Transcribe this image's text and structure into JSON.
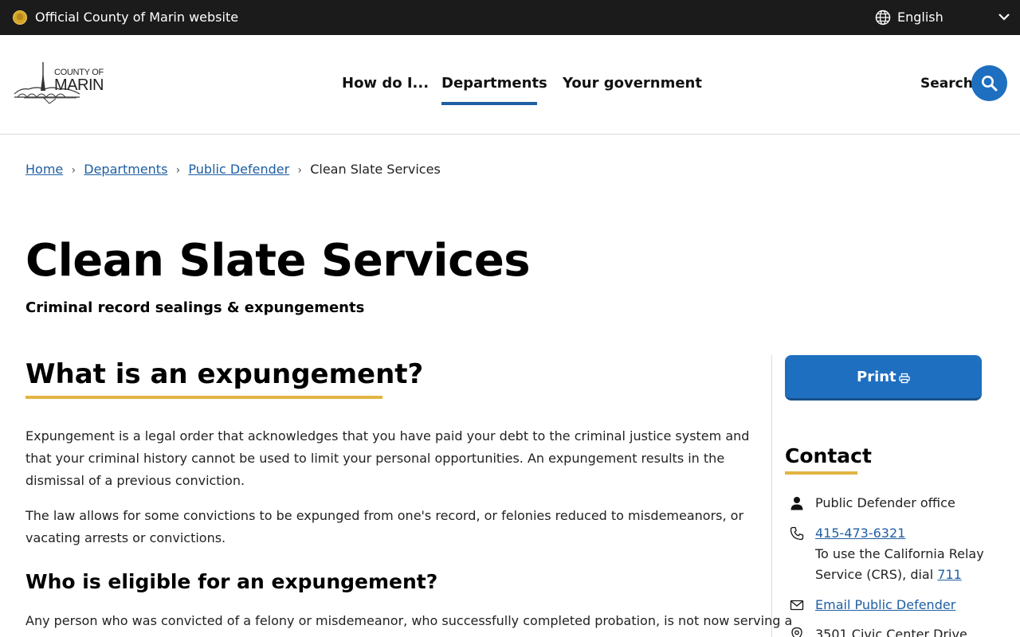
{
  "topbar": {
    "title": "Official County of Marin website",
    "language": "English"
  },
  "logo": {
    "top": "COUNTY OF",
    "main": "MARIN"
  },
  "nav": {
    "items": [
      {
        "label": "How do I..."
      },
      {
        "label": "Departments",
        "active": true
      },
      {
        "label": "Your government"
      }
    ],
    "search_label": "Search"
  },
  "breadcrumb": {
    "items": [
      "Home",
      "Departments",
      "Public Defender"
    ],
    "current": "Clean Slate Services"
  },
  "page": {
    "title": "Clean Slate Services",
    "subtitle": "Criminal record sealings & expungements"
  },
  "main": {
    "heading": "What is an expungement?",
    "para1": "Expungement is a legal order that acknowledges that you have paid your debt to the criminal justice system and that your criminal history cannot be used to limit your personal opportunities. An expungement results in the dismissal of a previous conviction.",
    "para2": "The law allows for some convictions to be expunged from one's record, or felonies reduced to misdemeanors, or vacating arrests or convictions.",
    "subheading": "Who is eligible for an expungement?",
    "para3": "Any person who was convicted of a felony or misdemeanor, who successfully completed probation, is not now serving a"
  },
  "sidebar": {
    "print_label": "Print",
    "contact_title": "Contact",
    "office": "Public Defender office",
    "phone": "415-473-6321",
    "relay_text": "To use the California Relay Service (CRS), dial",
    "relay_number": "711",
    "email_label": "Email Public Defender",
    "address": "3501 Civic Center Drive"
  },
  "colors": {
    "topbar_bg": "#1b1b1b",
    "accent_blue": "#1f6fc0",
    "link_blue": "#1f5fa3",
    "gold": "#e2b442"
  }
}
